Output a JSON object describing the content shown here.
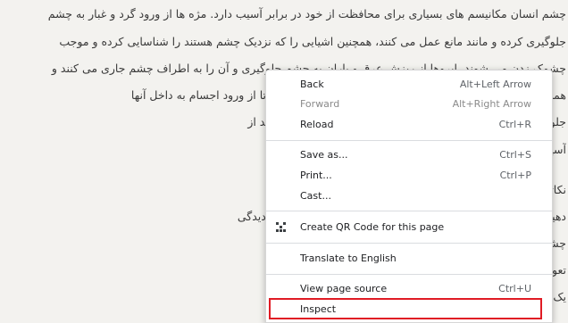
{
  "article": {
    "lines": [
      "چشم انسان مکانیسم های بسیاری برای محافظت از خود در برابر آسیب دارد. مژه ها از ورود گرد و غبار به چشم",
      "جلوگیری کرده و مانند مانع عمل می کنند، همچنین اشیایی را که نزدیک چشم هستند را شناسایی کرده و موجب",
      "چشمک زدن می شوند. ابروها از ریزش عرق و باران به چشم جلوگیری و آن را به اطراف چشم جاری می کنند و",
      "همچنین پلک ها نیز مانند سپری هستند که چشم ها را می پوشانند تا از ورود اجسام به داخل آنها",
      "جلوگیری کنند. اما باید بدانید همه این اقدامات محافظتی نمی توانند از",
      "آسیب",
      "نکاتی که می توانید پس از آسیب دیدگی چشم انجام",
      "دهید آسیب دیدگی چشم در اسرع وقت اهمیت زیادی دارد. آسیب دیدگی",
      "چشم را که گیرنده درد ندارد تحت تاثیر قرار دهد. به",
      "تعویق می تواند منجر به از دست دادن دائمی بینایی شود. فقط",
      "یک ب به شما پیشنهاد دهد. در این بخش از بهداشت و"
    ]
  },
  "context_menu": {
    "back": {
      "label": "Back",
      "shortcut": "Alt+Left Arrow"
    },
    "forward": {
      "label": "Forward",
      "shortcut": "Alt+Right Arrow"
    },
    "reload": {
      "label": "Reload",
      "shortcut": "Ctrl+R"
    },
    "save_as": {
      "label": "Save as...",
      "shortcut": "Ctrl+S"
    },
    "print": {
      "label": "Print...",
      "shortcut": "Ctrl+P"
    },
    "cast": {
      "label": "Cast..."
    },
    "qr_code": {
      "label": "Create QR Code for this page",
      "icon": "qr-code-icon"
    },
    "translate": {
      "label": "Translate to English"
    },
    "view_source": {
      "label": "View page source",
      "shortcut": "Ctrl+U"
    },
    "inspect": {
      "label": "Inspect"
    }
  },
  "colors": {
    "highlight_border": "#e01b24",
    "menu_background": "#ffffff",
    "page_background": "#f3f2ef"
  }
}
